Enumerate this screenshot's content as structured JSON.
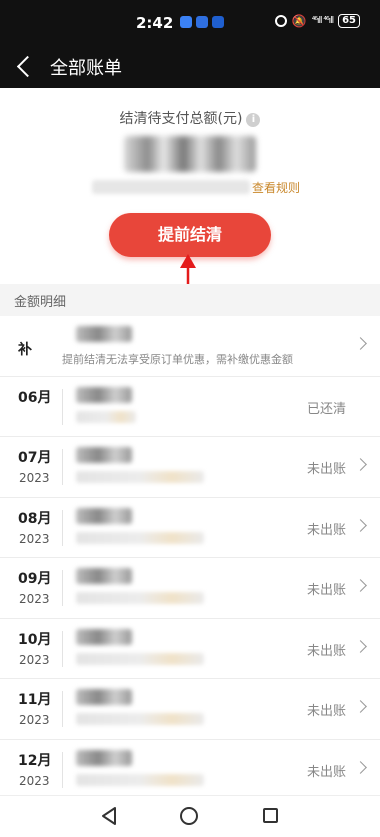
{
  "status_bar": {
    "time": "2:42",
    "battery": "65",
    "signal": "⁴⁶ıll ⁴⁶ıll"
  },
  "header": {
    "title": "全部账单"
  },
  "summary": {
    "label": "结清待支付总额(元)",
    "rules_link": "查看规则",
    "prepay_button": "提前结清"
  },
  "details": {
    "section_title": "金额明细",
    "rows": [
      {
        "month": "补",
        "year": "",
        "sub": "提前结清无法享受原订单优惠，需补缴优惠金额",
        "status": "",
        "chevron": true
      },
      {
        "month": "06月",
        "year": "",
        "sub": "",
        "status": "已还清",
        "chevron": false
      },
      {
        "month": "07月",
        "year": "2023",
        "sub": "",
        "status": "未出账",
        "chevron": true
      },
      {
        "month": "08月",
        "year": "2023",
        "sub": "",
        "status": "未出账",
        "chevron": true
      },
      {
        "month": "09月",
        "year": "2023",
        "sub": "",
        "status": "未出账",
        "chevron": true
      },
      {
        "month": "10月",
        "year": "2023",
        "sub": "",
        "status": "未出账",
        "chevron": true
      },
      {
        "month": "11月",
        "year": "2023",
        "sub": "",
        "status": "未出账",
        "chevron": true
      },
      {
        "month": "12月",
        "year": "2023",
        "sub": "",
        "status": "未出账",
        "chevron": true
      }
    ]
  },
  "colors": {
    "accent": "#e8463a",
    "header_bg": "#111111",
    "link": "#c9882c"
  }
}
